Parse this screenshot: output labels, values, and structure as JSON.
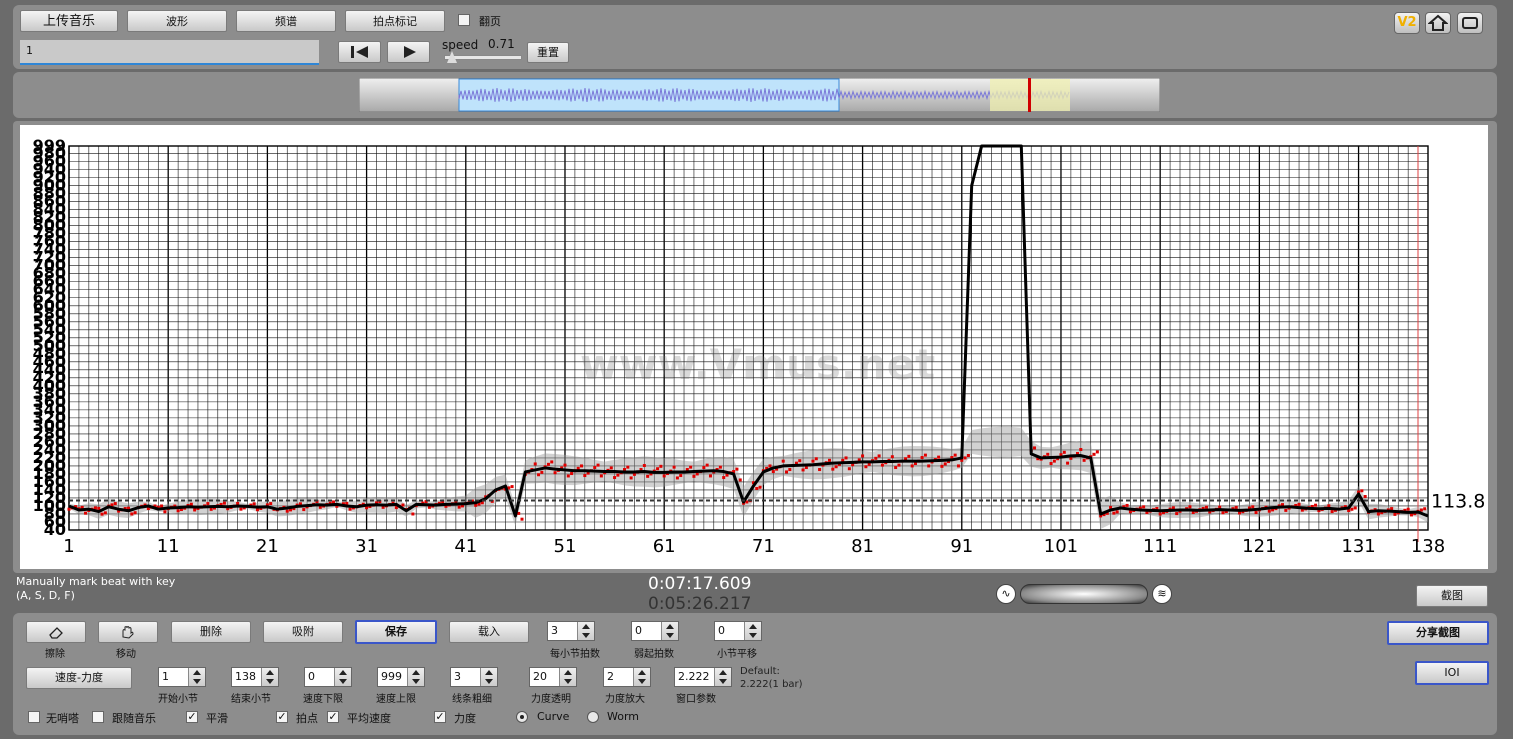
{
  "toolbar": {
    "upload_label": "上传音乐",
    "waveform_label": "波形",
    "spectrum_label": "频谱",
    "beat_mark_label": "拍点标记",
    "page_turn_label": "翻页",
    "file_value": "1",
    "speed_label": "speed",
    "speed_value": "0.71",
    "reset_label": "重置",
    "v2_label": "V2"
  },
  "chart_data": {
    "type": "line",
    "x_tick_labels": [
      "1",
      "11",
      "21",
      "31",
      "41",
      "51",
      "61",
      "71",
      "81",
      "91",
      "101",
      "111",
      "121",
      "131",
      "138"
    ],
    "y_tick_labels": [
      "40",
      "60",
      "80",
      "100",
      "120",
      "140",
      "160",
      "180",
      "200",
      "220",
      "240",
      "260",
      "280",
      "300",
      "320",
      "340",
      "360",
      "380",
      "400",
      "420",
      "440",
      "460",
      "480",
      "500",
      "520",
      "540",
      "560",
      "580",
      "600",
      "620",
      "640",
      "660",
      "680",
      "700",
      "720",
      "740",
      "760",
      "780",
      "800",
      "820",
      "840",
      "860",
      "880",
      "900",
      "920",
      "940",
      "960",
      "980",
      "999"
    ],
    "xlim": [
      1,
      138
    ],
    "ylim": [
      40,
      999
    ],
    "reference_line": {
      "value": 113.8,
      "label": "113.8"
    },
    "watermark": "www.Vmus.net",
    "series": [
      {
        "x": [
          1,
          2,
          3,
          4,
          5,
          6,
          7,
          8,
          9,
          10,
          11,
          12,
          13,
          14,
          15,
          16,
          17,
          18,
          19,
          20,
          21,
          22,
          23,
          24,
          25,
          26,
          27,
          28,
          29,
          30,
          31,
          32,
          33,
          34,
          35,
          36,
          37,
          38,
          39,
          40,
          41,
          42,
          43,
          44,
          45,
          46,
          47,
          48,
          49,
          50,
          51,
          52,
          53,
          54,
          55,
          56,
          57,
          58,
          59,
          60,
          61,
          62,
          63,
          64,
          65,
          66,
          67,
          68,
          69,
          70,
          71,
          72,
          73,
          74,
          75,
          76,
          77,
          78,
          79,
          80,
          81,
          82,
          83,
          84,
          85,
          86,
          87,
          88,
          89,
          90,
          91,
          92,
          93,
          94,
          95,
          96,
          97,
          98,
          99,
          100,
          101,
          102,
          103,
          104,
          105,
          106,
          107,
          108,
          109,
          110,
          111,
          112,
          113,
          114,
          115,
          116,
          117,
          118,
          119,
          120,
          121,
          122,
          123,
          124,
          125,
          126,
          127,
          128,
          129,
          130,
          131,
          132,
          133,
          134,
          135,
          136,
          137,
          138
        ],
        "values": [
          100,
          90,
          92,
          86,
          98,
          92,
          88,
          96,
          100,
          92,
          95,
          96,
          98,
          97,
          98,
          99,
          98,
          100,
          99,
          97,
          98,
          92,
          95,
          99,
          101,
          103,
          102,
          104,
          100,
          98,
          102,
          103,
          102,
          104,
          88,
          104,
          103,
          102,
          104,
          105,
          106,
          108,
          118,
          140,
          150,
          75,
          185,
          190,
          195,
          192,
          190,
          188,
          188,
          187,
          186,
          186,
          185,
          185,
          186,
          184,
          184,
          185,
          185,
          186,
          187,
          188,
          186,
          180,
          110,
          150,
          185,
          195,
          200,
          201,
          202,
          203,
          205,
          207,
          208,
          209,
          210,
          210,
          211,
          211,
          212,
          212,
          212,
          213,
          214,
          215,
          220,
          900,
          999,
          999,
          999,
          999,
          999,
          230,
          220,
          221,
          222,
          225,
          226,
          220,
          80,
          90,
          95,
          92,
          90,
          89,
          88,
          89,
          90,
          90,
          89,
          90,
          91,
          90,
          89,
          90,
          92,
          95,
          97,
          98,
          96,
          94,
          93,
          94,
          92,
          95,
          130,
          86,
          88,
          87,
          86,
          84,
          85,
          75
        ]
      }
    ]
  },
  "status": {
    "manual_hint_line1": "Manually mark beat with key",
    "manual_hint_line2": "(A, S, D, F)",
    "time_current": "0:07:17.609",
    "time_total": "0:05:26.217",
    "screenshot_label": "截图"
  },
  "controls": {
    "erase_label": "擦除",
    "move_label": "移动",
    "delete_label": "删除",
    "snap_label": "吸附",
    "save_label": "保存",
    "load_label": "载入",
    "beats_per_bar_value": "3",
    "beats_per_bar_label": "每小节拍数",
    "pickup_value": "0",
    "pickup_label": "弱起拍数",
    "bar_shift_value": "0",
    "bar_shift_label": "小节平移",
    "share_label": "分享截图",
    "tempo_dynamics_label": "速度-力度",
    "start_bar_value": "1",
    "start_bar_label": "开始小节",
    "end_bar_value": "138",
    "end_bar_label": "结束小节",
    "tempo_min_value": "0",
    "tempo_min_label": "速度下限",
    "tempo_max_value": "999",
    "tempo_max_label": "速度上限",
    "line_width_value": "3",
    "line_width_label": "线条粗细",
    "dyn_opacity_value": "20",
    "dyn_opacity_label": "力度透明",
    "dyn_scale_value": "2",
    "dyn_scale_label": "力度放大",
    "window_param_value": "2.222",
    "window_param_label": "窗口参数",
    "default_line1": "Default:",
    "default_line2": "2.222(1 bar)",
    "ioi_label": "IOI",
    "no_metronome_label": "无哨嗒",
    "follow_music_label": "跟随音乐",
    "smooth_label": "平滑",
    "beat_points_label": "拍点",
    "avg_tempo_label": "平均速度",
    "dynamics_label": "力度",
    "curve_label": "Curve",
    "worm_label": "Worm"
  }
}
